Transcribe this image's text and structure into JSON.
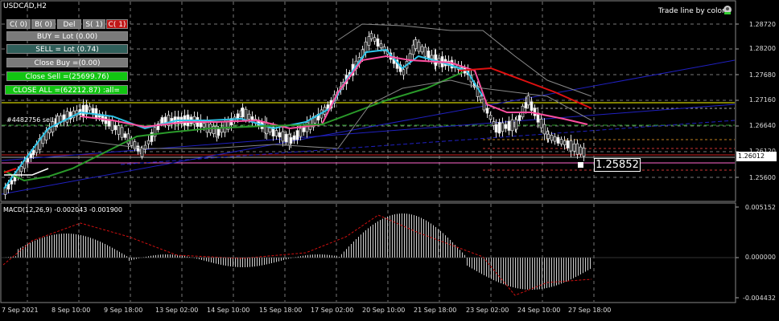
{
  "chart": {
    "symbol_title": "USDCAD,H2",
    "trade_line_label": "Trade line by color",
    "order_label": "#4482756 sell",
    "current_price_box": "1.25852",
    "bid_price_label": "1.26012",
    "price_axis": [
      "1.28720",
      "1.28200",
      "1.27680",
      "1.27160",
      "1.26640",
      "1.26120",
      "1.25600"
    ],
    "time_axis": [
      "7 Sep 2021",
      "8 Sep 10:00",
      "9 Sep 18:00",
      "13 Sep 02:00",
      "14 Sep 10:00",
      "15 Sep 18:00",
      "17 Sep 02:00",
      "20 Sep 10:00",
      "21 Sep 18:00",
      "23 Sep 02:00",
      "24 Sep 10:00",
      "27 Sep 18:00"
    ],
    "colors": {
      "background": "#000000",
      "grid": "#777777",
      "candle_up": "#ffffff",
      "ma_fast": "#2ec4e8",
      "ma_mid": "#ff4fa0",
      "ma_slow": "#e01010",
      "ma_long": "#2a9a2a",
      "trend": "#2020c0",
      "yellow": "#ffff00"
    }
  },
  "panel": {
    "close_count": "C( 0)",
    "buy_count": "B( 0)",
    "del_label": "Del",
    "sell_count": "S( 1)",
    "close_all_count": "C( 1)",
    "buy_lot": "BUY = Lot (0.00)",
    "sell_lot": "SELL = Lot (0.74)",
    "close_buy": "Close  Buy =(0.00)",
    "close_sell": "Close  Sell =(25699.76)",
    "close_all": "CLOSE  ALL =(62212.87) :all="
  },
  "macd": {
    "label": "MACD(12,26,9) -0.002043 -0.001900",
    "axis": [
      "0.005152",
      "0.000000",
      "-0.004432"
    ]
  }
}
